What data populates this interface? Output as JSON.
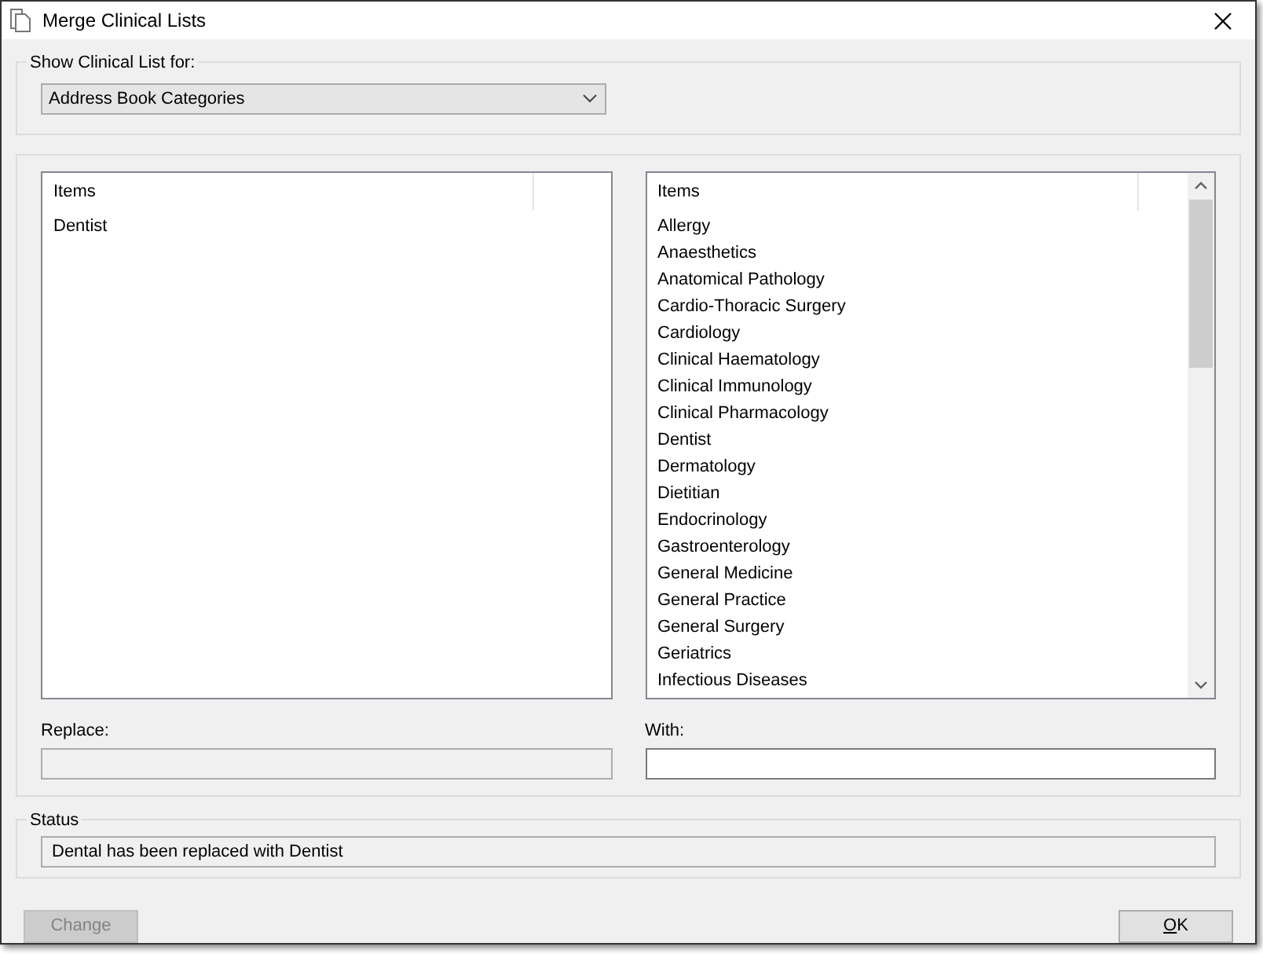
{
  "window": {
    "title": "Merge Clinical Lists"
  },
  "show_list_for": {
    "label": "Show Clinical List for:",
    "value": "Address Book Categories"
  },
  "left_list": {
    "header": "Items",
    "items": [
      "Dentist"
    ]
  },
  "right_list": {
    "header": "Items",
    "items": [
      "Allergy",
      "Anaesthetics",
      "Anatomical Pathology",
      "Cardio-Thoracic Surgery",
      "Cardiology",
      "Clinical Haematology",
      "Clinical Immunology",
      "Clinical Pharmacology",
      "Dentist",
      "Dermatology",
      "Dietitian",
      "Endocrinology",
      "Gastroenterology",
      "General Medicine",
      "General Practice",
      "General Surgery",
      "Geriatrics",
      "Infectious Diseases"
    ]
  },
  "replace": {
    "label": "Replace:",
    "disabled": true
  },
  "with": {
    "label": "With:",
    "disabled": false
  },
  "status": {
    "label": "Status",
    "value": "Dental has been replaced with Dentist"
  },
  "buttons": [
    {
      "label": "Change",
      "disabled": true,
      "underline_first": false
    },
    {
      "label": "OK",
      "disabled": false,
      "underline_first": true
    }
  ]
}
